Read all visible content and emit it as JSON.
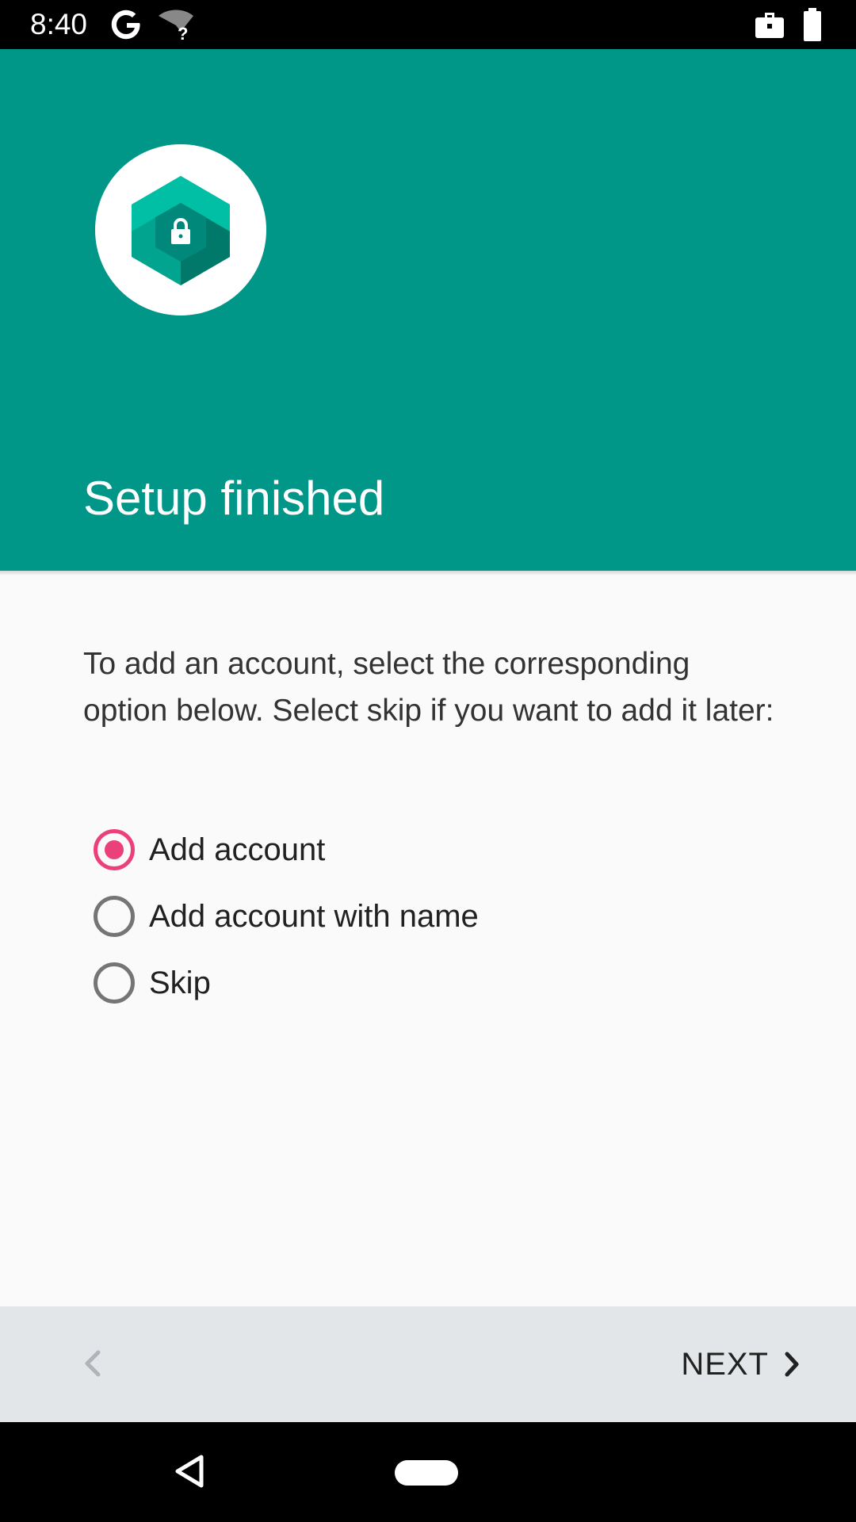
{
  "status_bar": {
    "time": "8:40",
    "icons": [
      "google-g-icon",
      "wifi-unknown-icon",
      "work-profile-icon",
      "battery-icon"
    ]
  },
  "header": {
    "background_color": "#009688",
    "logo_icon": "shield-lock-hexagon-icon",
    "title": "Setup finished"
  },
  "body": {
    "description": "To add an account, select the corresponding option below. Select skip if you want to add it later:",
    "options": [
      {
        "label": "Add account",
        "selected": true
      },
      {
        "label": "Add account with name",
        "selected": false
      },
      {
        "label": "Skip",
        "selected": false
      }
    ],
    "accent_color": "#ec407a"
  },
  "footer": {
    "back_icon": "chevron-left-icon",
    "next_label": "NEXT",
    "next_icon": "chevron-right-icon"
  },
  "system_nav": {
    "icons": [
      "nav-back-icon",
      "nav-home-pill"
    ]
  }
}
